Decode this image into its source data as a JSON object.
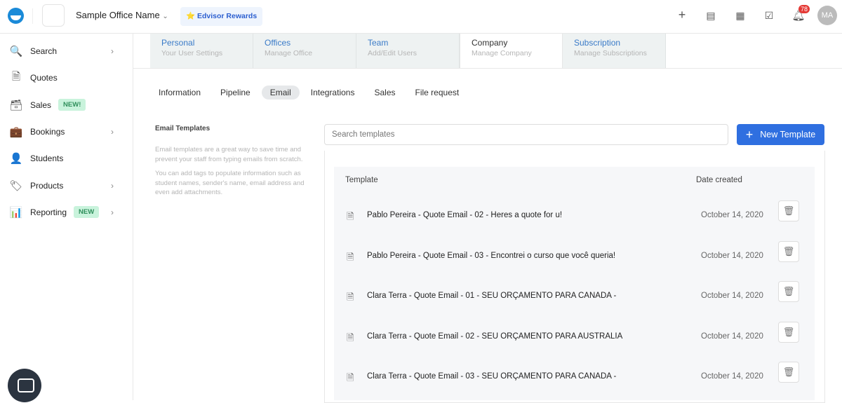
{
  "header": {
    "office_name": "Sample Office Name",
    "rewards": "⭐ Edvisor Rewards",
    "notification_count": "78",
    "avatar": "MA"
  },
  "sidebar": {
    "items": [
      {
        "label": "Search",
        "icon": "🔍",
        "chevron": true
      },
      {
        "label": "Quotes",
        "icon": "🗎"
      },
      {
        "label": "Sales",
        "icon": "🗃",
        "tag": "NEW!"
      },
      {
        "label": "Bookings",
        "icon": "💼",
        "chevron": true
      },
      {
        "label": "Students",
        "icon": "👤"
      },
      {
        "label": "Products",
        "icon": "🏷",
        "chevron": true
      },
      {
        "label": "Reporting",
        "icon": "📊",
        "tag": "NEW",
        "chevron": true
      }
    ]
  },
  "tabs": [
    {
      "title": "Personal",
      "subtitle": "Your User Settings"
    },
    {
      "title": "Offices",
      "subtitle": "Manage Office"
    },
    {
      "title": "Team",
      "subtitle": "Add/Edit Users"
    },
    {
      "title": "Company",
      "subtitle": "Manage Company"
    },
    {
      "title": "Subscription",
      "subtitle": "Manage Subscriptions"
    }
  ],
  "subtabs": [
    "Information",
    "Pipeline",
    "Email",
    "Integrations",
    "Sales",
    "File request"
  ],
  "info": {
    "heading": "Email Templates",
    "p1": "Email templates are a great way to save time and prevent your staff from typing emails from scratch.",
    "p2": "You can add tags to populate information such as student names, sender's name, email address and even add attachments."
  },
  "search": {
    "placeholder": "Search templates"
  },
  "new_template": "New Template",
  "table": {
    "col_template": "Template",
    "col_date": "Date created",
    "rows": [
      {
        "name": "Pablo Pereira - Quote Email - 02 - Heres a quote for u!",
        "date": "October 14, 2020"
      },
      {
        "name": "Pablo Pereira - Quote Email - 03 - Encontrei o curso que você queria!",
        "date": "October 14, 2020"
      },
      {
        "name": "Clara Terra - Quote Email - 01 - SEU ORÇAMENTO PARA CANADA -",
        "date": "October 14, 2020"
      },
      {
        "name": "Clara Terra - Quote Email - 02 - SEU ORÇAMENTO PARA AUSTRALIA",
        "date": "October 14, 2020"
      },
      {
        "name": "Clara Terra - Quote Email - 03 - SEU ORÇAMENTO PARA CANADA -",
        "date": "October 14, 2020"
      }
    ]
  }
}
